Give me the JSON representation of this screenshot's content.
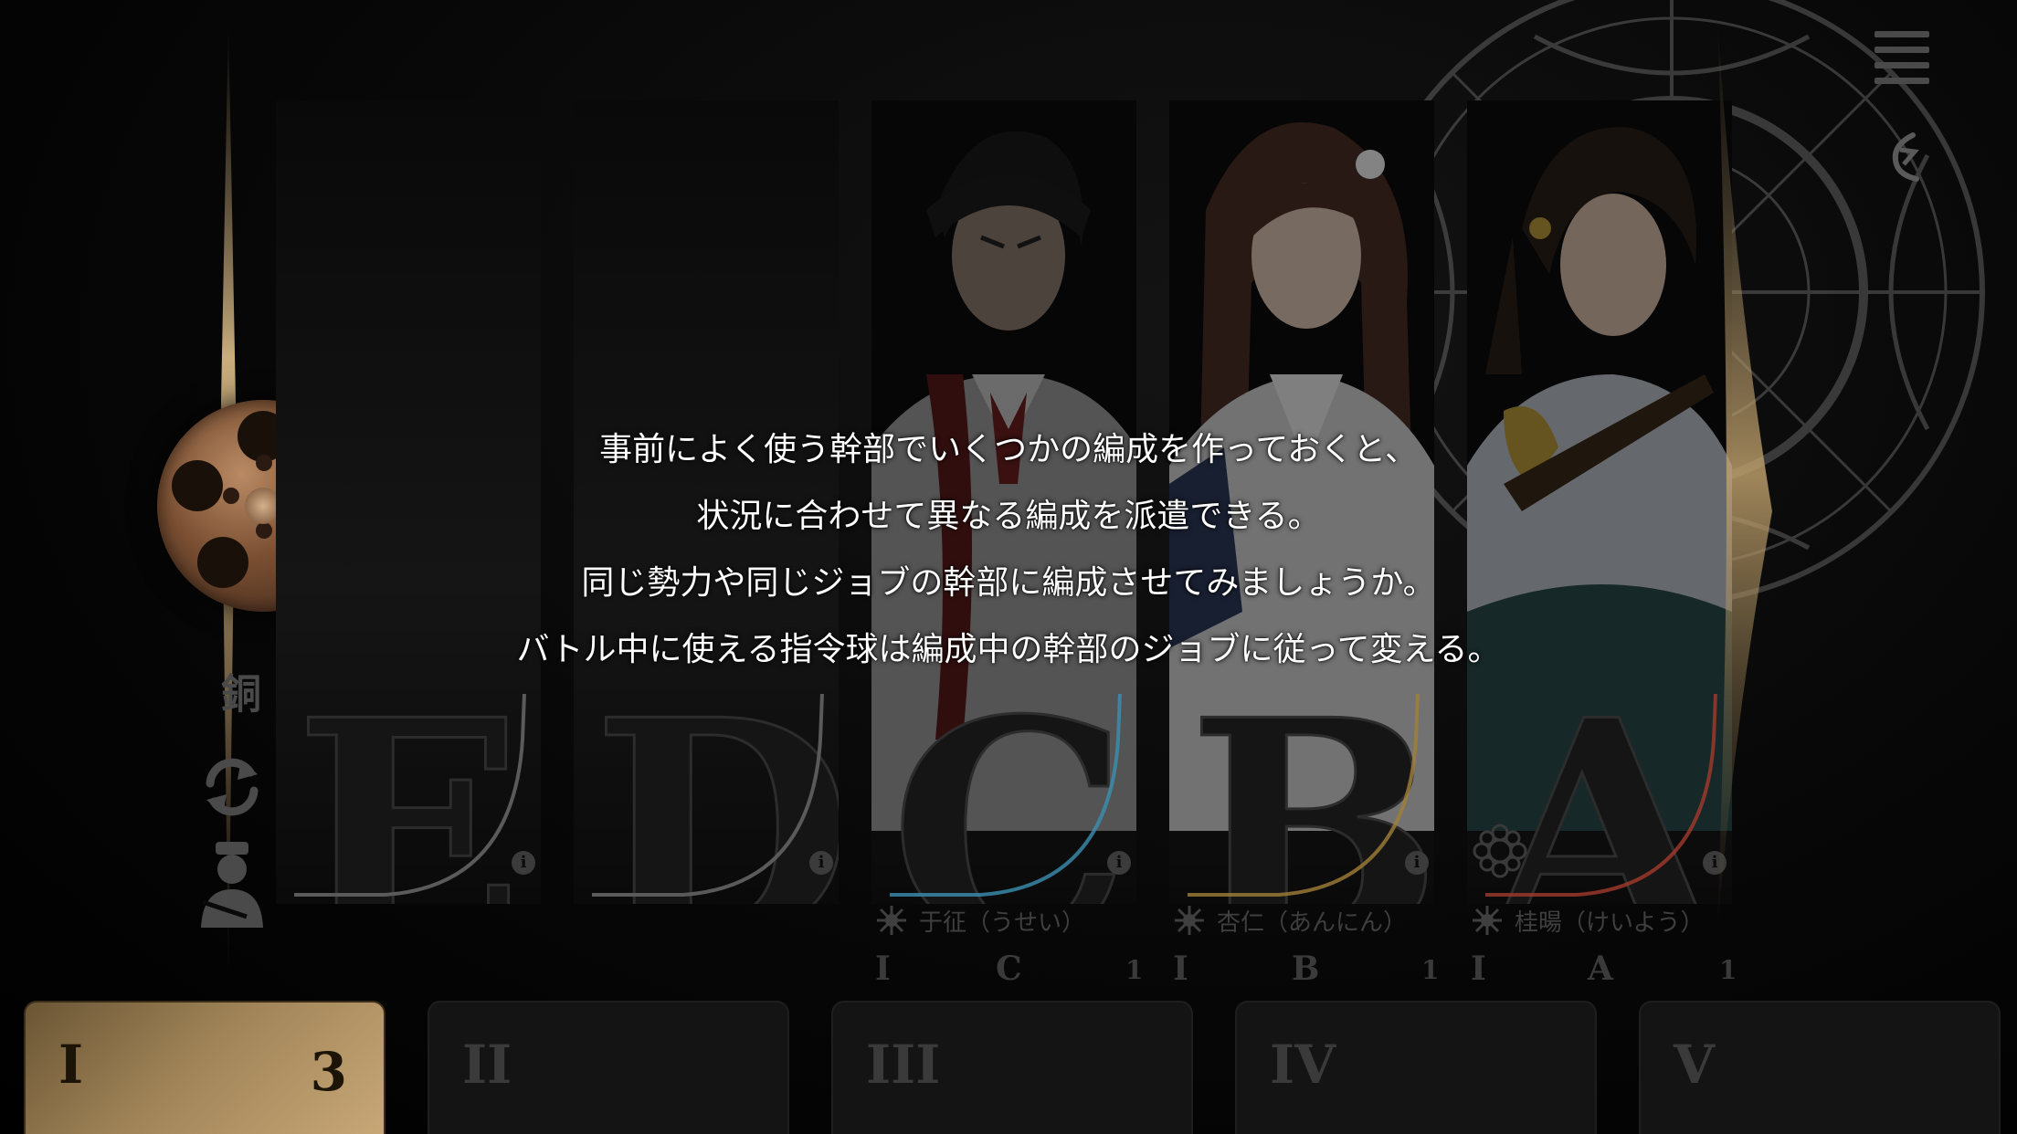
{
  "rank": {
    "label": "銅 I"
  },
  "slots": [
    {
      "letter": "E",
      "rim_color": "#6a6a6a",
      "character": null
    },
    {
      "letter": "D",
      "rim_color": "#6a6a6a",
      "character": null
    },
    {
      "letter": "C",
      "rim_color": "#3b8fb0",
      "character": {
        "name": "于征（うせい）",
        "level": "I",
        "grade": "C",
        "stars": "1"
      }
    },
    {
      "letter": "B",
      "rim_color": "#a07f38",
      "character": {
        "name": "杏仁（あんにん）",
        "level": "I",
        "grade": "B",
        "stars": "1"
      }
    },
    {
      "letter": "A",
      "rim_color": "#a23a2a",
      "character": {
        "name": "桂暘（けいよう）",
        "level": "I",
        "grade": "A",
        "stars": "1"
      }
    }
  ],
  "tabs": [
    {
      "label": "I",
      "count": "3",
      "active": true
    },
    {
      "label": "II",
      "active": false
    },
    {
      "label": "III",
      "active": false
    },
    {
      "label": "IV",
      "active": false
    },
    {
      "label": "V",
      "active": false
    }
  ],
  "tip": {
    "lines": [
      "事前によく使う幹部でいくつかの編成を作っておくと、",
      "状況に合わせて異なる編成を派遣できる。",
      "同じ勢力や同じジョブの幹部に編成させてみましょうか。",
      "バトル中に使える指令球は編成中の幹部のジョブに従って変える。"
    ]
  },
  "icons": {
    "menu": "hamburger-menu-icon",
    "back": "back-arrow-icon",
    "swap": "swap-arrows-icon",
    "auto": "auto-assign-icon",
    "info": "info-icon",
    "faction": "sun-burst-icon"
  }
}
